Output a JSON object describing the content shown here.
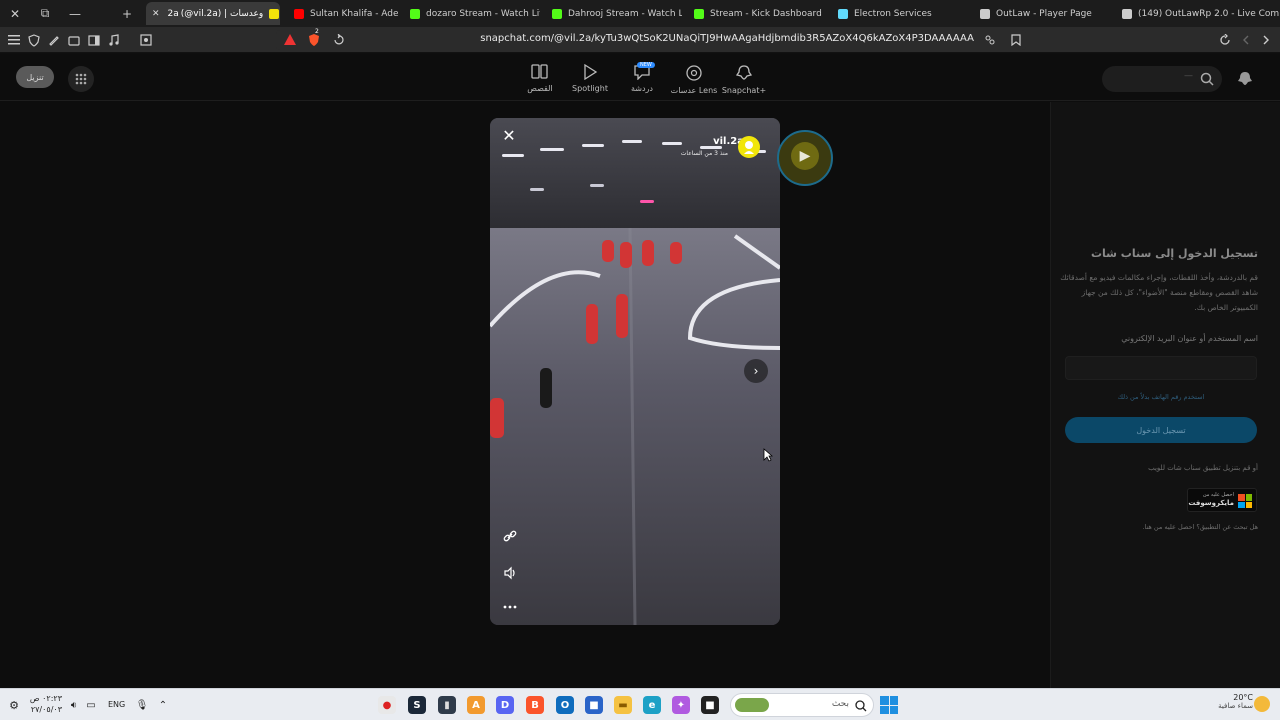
{
  "browser": {
    "tabs": [
      {
        "label": "(@vil.2a) | وعدسات",
        "fav": "snapchat",
        "favColor": "#f5e20a",
        "active": true
      },
      {
        "label": "Sultan Khalifa - Adeel El Rooh",
        "fav": "youtube",
        "favColor": "#ff0000",
        "active": false
      },
      {
        "label": "dozaro Stream - Watch Live on",
        "fav": "kick",
        "favColor": "#53fc18",
        "active": false
      },
      {
        "label": "Dahrooj Stream - Watch Live o",
        "fav": "kick",
        "favColor": "#53fc18",
        "active": false
      },
      {
        "label": "Stream - Kick Dashboard",
        "fav": "kick",
        "favColor": "#53fc18",
        "active": false
      },
      {
        "label": "Electron Services",
        "fav": "react",
        "favColor": "#61dafb",
        "active": false
      },
      {
        "label": "OutLaw - Player Page",
        "fav": "outlaw",
        "favColor": "#cccccc",
        "active": false
      },
      {
        "label": "(149) OutLawRp 2.0 - Live Com",
        "fav": "outlaw",
        "favColor": "#cccccc",
        "active": false
      }
    ],
    "active_tab_prefix": "2a",
    "url": "snapchat.com/@vil.2a/kyTu3wQtSoK2UNaQiTJ9HwAAgaHdjbmdib3R5AZoX4Q6kAZoX4P3DAAAAAA",
    "brave_badge": "2"
  },
  "snapchat": {
    "download_label": "تنزيل",
    "nav": [
      {
        "label": "القصص",
        "icon": "stories-icon"
      },
      {
        "label": "Spotlight",
        "icon": "spotlight-play-icon"
      },
      {
        "label": "دردشة",
        "icon": "chat-icon",
        "badge": "NEW"
      },
      {
        "label": "عدسات Lens",
        "icon": "lens-icon"
      },
      {
        "label": "Snapchat+",
        "icon": "snapchat-plus-icon"
      }
    ],
    "search_placeholder": "—",
    "story": {
      "username": "vil.2a",
      "time": "منذ 3 من الساعات",
      "accent": "#f1e60a"
    },
    "login": {
      "title": "تسجيل الدخول إلى سناب شات",
      "description": "قم بالدردشة، وأخذ اللقطات، وإجراء مكالمات فيديو مع أصدقائك شاهد القصص ومقاطع منصة \"الأضواء\"، كل ذلك من جهاز الكمبيوتر الخاص بك.",
      "username_label": "اسم المستخدم أو عنوان البريد الإلكتروني",
      "phone_link": "استخدم رقم الهاتف بدلاً من ذلك",
      "login_button": "تسجيل الدخول",
      "or_text": "أو قم بتنزيل تطبيق سناب شات للويب",
      "ms_line1": "احصل عليه من",
      "ms_line2": "مايكروسوفت",
      "help_text": "هل تبحث عن التطبيق؟ احصل عليه من هنا."
    }
  },
  "taskbar": {
    "weather_temp": "20°C",
    "weather_cond": "سماء صافية",
    "search_placeholder": "بحث",
    "clock_time": "٠٢:٢٣ ص",
    "clock_date": "٢٧/٠٥/٠٣",
    "lang": "ENG",
    "apps": [
      {
        "name": "taskbar-app-colorful",
        "bg": "#e8e8e8",
        "glyph": "●",
        "fg": "#d22"
      },
      {
        "name": "taskbar-app-steam",
        "bg": "#1b2838",
        "glyph": "S",
        "fg": "#fff"
      },
      {
        "name": "taskbar-app-terminal",
        "bg": "#2f3b4a",
        "glyph": "▮",
        "fg": "#ddd"
      },
      {
        "name": "taskbar-app-fortnite",
        "bg": "#f29a2e",
        "glyph": "A",
        "fg": "#fff"
      },
      {
        "name": "taskbar-app-discord",
        "bg": "#5865f2",
        "glyph": "D",
        "fg": "#fff"
      },
      {
        "name": "taskbar-app-brave",
        "bg": "#fb542b",
        "glyph": "B",
        "fg": "#fff"
      },
      {
        "name": "taskbar-app-outlook",
        "bg": "#0f6cbd",
        "glyph": "O",
        "fg": "#fff"
      },
      {
        "name": "taskbar-app-store",
        "bg": "#2a64c8",
        "glyph": "■",
        "fg": "#fff"
      },
      {
        "name": "taskbar-app-explorer",
        "bg": "#f5c242",
        "glyph": "▬",
        "fg": "#8a5a00"
      },
      {
        "name": "taskbar-app-edge",
        "bg": "#1da1c6",
        "glyph": "e",
        "fg": "#fff"
      },
      {
        "name": "taskbar-app-copilot",
        "bg": "#b05ae0",
        "glyph": "✦",
        "fg": "#fff"
      },
      {
        "name": "taskbar-app-black",
        "bg": "#222",
        "glyph": "■",
        "fg": "#fff"
      }
    ]
  }
}
